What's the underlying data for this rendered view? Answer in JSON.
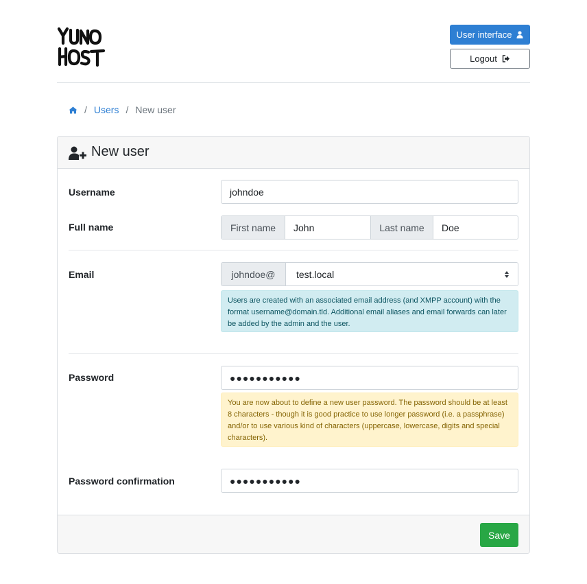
{
  "header": {
    "logo_text": "YUNOHOST",
    "user_interface_label": "User interface",
    "logout_label": "Logout"
  },
  "breadcrumb": {
    "users": "Users",
    "current": "New user"
  },
  "form": {
    "title": "New user",
    "username": {
      "label": "Username",
      "value": "johndoe"
    },
    "fullname": {
      "label": "Full name",
      "first_addon": "First name",
      "first_value": "John",
      "last_addon": "Last name",
      "last_value": "Doe"
    },
    "email": {
      "label": "Email",
      "prefix": "johndoe@",
      "domain": "test.local",
      "help": "Users are created with an associated email address (and XMPP account) with the format username@domain.tld. Additional email aliases and email forwards can later be added by the admin and the user."
    },
    "password": {
      "label": "Password",
      "dots": "●●●●●●●●●●●",
      "help": "You are now about to define a new user password. The password should be at least 8 characters - though it is good practice to use longer password (i.e. a passphrase) and/or to use various kind of characters (uppercase, lowercase, digits and special characters)."
    },
    "confirmation": {
      "label": "Password confirmation",
      "dots": "●●●●●●●●●●●"
    },
    "save_label": "Save"
  },
  "colors": {
    "primary": "#2e7fd3",
    "success": "#28a745"
  }
}
